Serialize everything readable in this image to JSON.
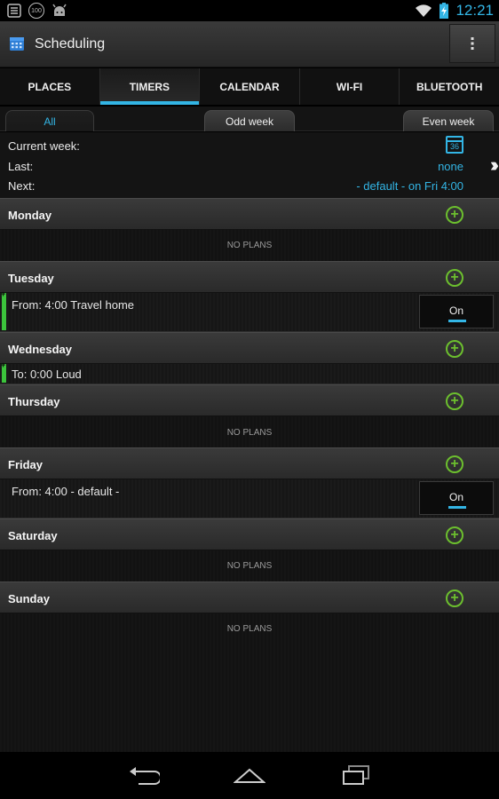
{
  "status": {
    "time": "12:21",
    "badge": "100"
  },
  "app": {
    "title": "Scheduling"
  },
  "tabs": [
    {
      "label": "PLACES"
    },
    {
      "label": "TIMERS"
    },
    {
      "label": "CALENDAR"
    },
    {
      "label": "WI-FI"
    },
    {
      "label": "BLUETOOTH"
    }
  ],
  "week_tabs": {
    "all": "All",
    "odd": "Odd week",
    "even": "Even week"
  },
  "info": {
    "current_label": "Current week:",
    "current_value": "36",
    "last_label": "Last:",
    "last_value": "none",
    "next_label": "Next:",
    "next_value": "- default - on Fri 4:00"
  },
  "days": [
    {
      "name": "Monday",
      "empty": "NO PLANS"
    },
    {
      "name": "Tuesday",
      "plan": "From: 4:00 Travel home",
      "toggle": "On"
    },
    {
      "name": "Wednesday",
      "plan": "To: 0:00 Loud"
    },
    {
      "name": "Thursday",
      "empty": "NO PLANS"
    },
    {
      "name": "Friday",
      "plan": "From: 4:00 - default -",
      "toggle": "On"
    },
    {
      "name": "Saturday",
      "empty": "NO PLANS"
    },
    {
      "name": "Sunday",
      "empty": "NO PLANS"
    }
  ],
  "colors": {
    "accent": "#33b5e5",
    "add": "#6cbf2e",
    "active_bar": "#3cc43c"
  }
}
